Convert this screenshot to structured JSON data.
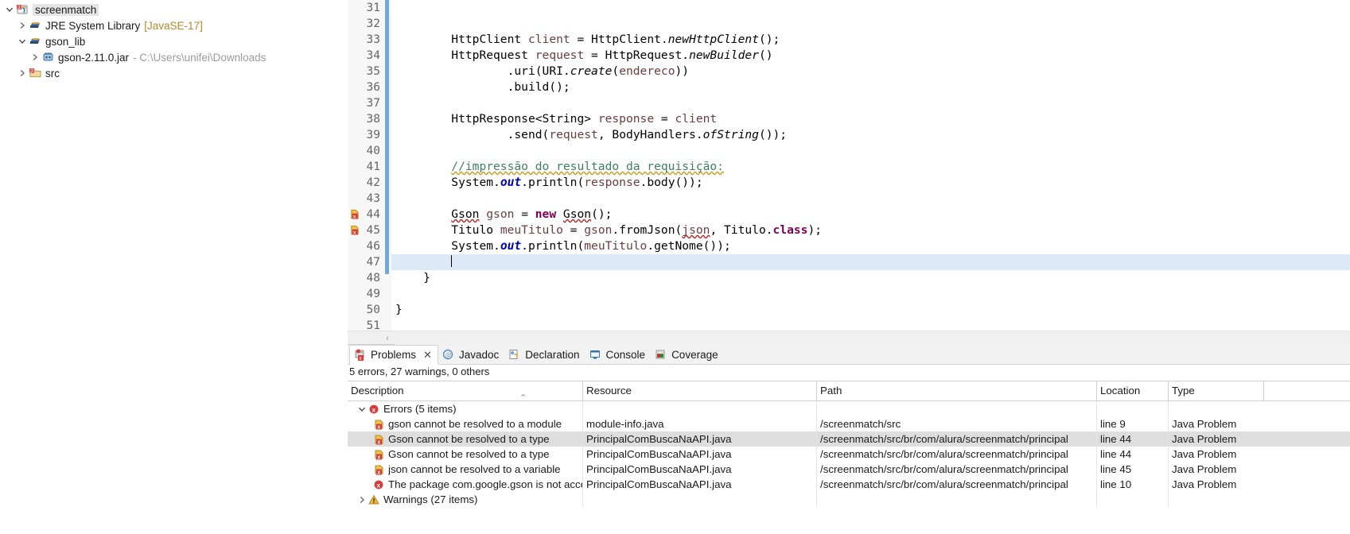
{
  "explorer": {
    "items": [
      {
        "label": "screenmatch",
        "sub": "",
        "icon": "java-project-icon",
        "indent": 1,
        "expanded": true,
        "selected": true
      },
      {
        "label": "JRE System Library",
        "sub": "[JavaSE-17]",
        "sub_style": "amber",
        "icon": "library-icon",
        "indent": 2,
        "expanded": false,
        "selected": false
      },
      {
        "label": "gson_lib",
        "sub": "",
        "icon": "library-icon",
        "indent": 2,
        "expanded": true,
        "selected": false
      },
      {
        "label": "gson-2.11.0.jar",
        "sub": "- C:\\Users\\unifei\\Downloads",
        "sub_style": "grey",
        "icon": "jar-icon",
        "indent": 3,
        "expanded": false,
        "selected": false
      },
      {
        "label": "src",
        "sub": "",
        "icon": "source-folder-icon",
        "indent": 2,
        "expanded": false,
        "selected": false
      }
    ]
  },
  "editor": {
    "first_line": 31,
    "last_line": 51,
    "highlighted_line": 47,
    "error_lines": [
      44,
      45
    ],
    "lines": [
      {
        "n": 31,
        "tokens": []
      },
      {
        "n": 32,
        "tokens": []
      },
      {
        "n": 33,
        "tokens": [
          {
            "t": "        ",
            "c": "pln"
          },
          {
            "t": "HttpClient",
            "c": "typ"
          },
          {
            "t": " ",
            "c": "pln"
          },
          {
            "t": "client",
            "c": "var"
          },
          {
            "t": " = ",
            "c": "pln"
          },
          {
            "t": "HttpClient",
            "c": "typ"
          },
          {
            "t": ".",
            "c": "pln"
          },
          {
            "t": "newHttpClient",
            "c": "mth"
          },
          {
            "t": "();",
            "c": "pln"
          }
        ]
      },
      {
        "n": 34,
        "tokens": [
          {
            "t": "        ",
            "c": "pln"
          },
          {
            "t": "HttpRequest",
            "c": "typ"
          },
          {
            "t": " ",
            "c": "pln"
          },
          {
            "t": "request",
            "c": "var"
          },
          {
            "t": " = ",
            "c": "pln"
          },
          {
            "t": "HttpRequest",
            "c": "typ"
          },
          {
            "t": ".",
            "c": "pln"
          },
          {
            "t": "newBuilder",
            "c": "mth"
          },
          {
            "t": "()",
            "c": "pln"
          }
        ]
      },
      {
        "n": 35,
        "tokens": [
          {
            "t": "                ",
            "c": "pln"
          },
          {
            "t": ".uri(",
            "c": "pln"
          },
          {
            "t": "URI",
            "c": "typ"
          },
          {
            "t": ".",
            "c": "pln"
          },
          {
            "t": "create",
            "c": "mth"
          },
          {
            "t": "(",
            "c": "pln"
          },
          {
            "t": "endereco",
            "c": "var"
          },
          {
            "t": "))",
            "c": "pln"
          }
        ]
      },
      {
        "n": 36,
        "tokens": [
          {
            "t": "                ",
            "c": "pln"
          },
          {
            "t": ".build();",
            "c": "pln"
          }
        ]
      },
      {
        "n": 37,
        "tokens": []
      },
      {
        "n": 38,
        "tokens": [
          {
            "t": "        ",
            "c": "pln"
          },
          {
            "t": "HttpResponse<String>",
            "c": "typ"
          },
          {
            "t": " ",
            "c": "pln"
          },
          {
            "t": "response",
            "c": "var"
          },
          {
            "t": " = ",
            "c": "pln"
          },
          {
            "t": "client",
            "c": "var"
          }
        ]
      },
      {
        "n": 39,
        "tokens": [
          {
            "t": "                ",
            "c": "pln"
          },
          {
            "t": ".send(",
            "c": "pln"
          },
          {
            "t": "request",
            "c": "var"
          },
          {
            "t": ", ",
            "c": "pln"
          },
          {
            "t": "BodyHandlers",
            "c": "typ"
          },
          {
            "t": ".",
            "c": "pln"
          },
          {
            "t": "ofString",
            "c": "mth"
          },
          {
            "t": "());",
            "c": "pln"
          }
        ]
      },
      {
        "n": 40,
        "tokens": []
      },
      {
        "n": 41,
        "tokens": [
          {
            "t": "        ",
            "c": "pln"
          },
          {
            "t": "//impressão do resultado da requisição:",
            "c": "cmt sqw"
          }
        ]
      },
      {
        "n": 42,
        "tokens": [
          {
            "t": "        ",
            "c": "pln"
          },
          {
            "t": "System",
            "c": "typ"
          },
          {
            "t": ".",
            "c": "pln"
          },
          {
            "t": "out",
            "c": "fld"
          },
          {
            "t": ".println(",
            "c": "pln"
          },
          {
            "t": "response",
            "c": "var"
          },
          {
            "t": ".body());",
            "c": "pln"
          }
        ]
      },
      {
        "n": 43,
        "tokens": []
      },
      {
        "n": 44,
        "tokens": [
          {
            "t": "        ",
            "c": "pln"
          },
          {
            "t": "Gson",
            "c": "typ sq"
          },
          {
            "t": " ",
            "c": "pln"
          },
          {
            "t": "gson",
            "c": "var"
          },
          {
            "t": " = ",
            "c": "pln"
          },
          {
            "t": "new",
            "c": "k"
          },
          {
            "t": " ",
            "c": "pln"
          },
          {
            "t": "Gson",
            "c": "typ sq"
          },
          {
            "t": "();",
            "c": "pln"
          }
        ]
      },
      {
        "n": 45,
        "tokens": [
          {
            "t": "        ",
            "c": "pln"
          },
          {
            "t": "Titulo",
            "c": "typ"
          },
          {
            "t": " ",
            "c": "pln"
          },
          {
            "t": "meuTitulo",
            "c": "var"
          },
          {
            "t": " = ",
            "c": "pln"
          },
          {
            "t": "gson",
            "c": "var"
          },
          {
            "t": ".fromJson(",
            "c": "pln"
          },
          {
            "t": "json",
            "c": "var sq"
          },
          {
            "t": ", ",
            "c": "pln"
          },
          {
            "t": "Titulo",
            "c": "typ"
          },
          {
            "t": ".",
            "c": "pln"
          },
          {
            "t": "class",
            "c": "k"
          },
          {
            "t": ");",
            "c": "pln"
          }
        ]
      },
      {
        "n": 46,
        "tokens": [
          {
            "t": "        ",
            "c": "pln"
          },
          {
            "t": "System",
            "c": "typ"
          },
          {
            "t": ".",
            "c": "pln"
          },
          {
            "t": "out",
            "c": "fld"
          },
          {
            "t": ".println(",
            "c": "pln"
          },
          {
            "t": "meuTitulo",
            "c": "var"
          },
          {
            "t": ".getNome());",
            "c": "pln"
          }
        ]
      },
      {
        "n": 47,
        "tokens": [
          {
            "t": "        ",
            "c": "pln"
          },
          {
            "t": "\u0000caret",
            "c": "caret"
          }
        ]
      },
      {
        "n": 48,
        "tokens": [
          {
            "t": "    }",
            "c": "pln"
          }
        ]
      },
      {
        "n": 49,
        "tokens": []
      },
      {
        "n": 50,
        "tokens": [
          {
            "t": "}",
            "c": "pln"
          }
        ]
      },
      {
        "n": 51,
        "tokens": []
      }
    ]
  },
  "bottom_panel": {
    "tabs": [
      {
        "label": "Problems",
        "icon": "problems-icon",
        "active": true,
        "closable": true,
        "close_glyph": "✕"
      },
      {
        "label": "Javadoc",
        "icon": "javadoc-icon",
        "active": false,
        "closable": false
      },
      {
        "label": "Declaration",
        "icon": "declaration-icon",
        "active": false,
        "closable": false
      },
      {
        "label": "Console",
        "icon": "console-icon",
        "active": false,
        "closable": false
      },
      {
        "label": "Coverage",
        "icon": "coverage-icon",
        "active": false,
        "closable": false
      }
    ],
    "summary": "5 errors, 27 warnings, 0 others",
    "columns": [
      "Description",
      "Resource",
      "Path",
      "Location",
      "Type"
    ],
    "sorted_column": "Description",
    "sort_glyph": "⌃",
    "rows": [
      {
        "kind": "group",
        "expanded": true,
        "icon": "error-group-icon",
        "description": "Errors (5 items)",
        "resource": "",
        "path": "",
        "location": "",
        "type": "",
        "selected": false
      },
      {
        "kind": "item",
        "icon": "error-marker-icon",
        "description": "gson cannot be resolved to a module",
        "resource": "module-info.java",
        "path": "/screenmatch/src",
        "location": "line 9",
        "type": "Java Problem",
        "selected": false
      },
      {
        "kind": "item",
        "icon": "error-marker-icon",
        "description": "Gson cannot be resolved to a type",
        "resource": "PrincipalComBuscaNaAPI.java",
        "path": "/screenmatch/src/br/com/alura/screenmatch/principal",
        "location": "line 44",
        "type": "Java Problem",
        "selected": true
      },
      {
        "kind": "item",
        "icon": "error-marker-icon",
        "description": "Gson cannot be resolved to a type",
        "resource": "PrincipalComBuscaNaAPI.java",
        "path": "/screenmatch/src/br/com/alura/screenmatch/principal",
        "location": "line 44",
        "type": "Java Problem",
        "selected": false
      },
      {
        "kind": "item",
        "icon": "error-marker-icon",
        "description": "json cannot be resolved to a variable",
        "resource": "PrincipalComBuscaNaAPI.java",
        "path": "/screenmatch/src/br/com/alura/screenmatch/principal",
        "location": "line 45",
        "type": "Java Problem",
        "selected": false
      },
      {
        "kind": "item",
        "icon": "error-round-icon",
        "description": "The package com.google.gson is not accessi",
        "resource": "PrincipalComBuscaNaAPI.java",
        "path": "/screenmatch/src/br/com/alura/screenmatch/principal",
        "location": "line 10",
        "type": "Java Problem",
        "selected": false
      },
      {
        "kind": "group",
        "expanded": false,
        "icon": "warning-group-icon",
        "description": "Warnings (27 items)",
        "resource": "",
        "path": "",
        "location": "",
        "type": "",
        "selected": false
      }
    ]
  },
  "colors": {
    "selection_blue": "#dce9f7",
    "fold_bar_blue": "#6fa8dc",
    "keyword_purple": "#7f0055",
    "comment_green": "#3f7f5f",
    "variable_brown": "#6a3e3e",
    "field_blue": "#0000c0",
    "error_red": "#cc0000",
    "warning_amber": "#e8a33d",
    "row_selected_grey": "#dedede"
  }
}
